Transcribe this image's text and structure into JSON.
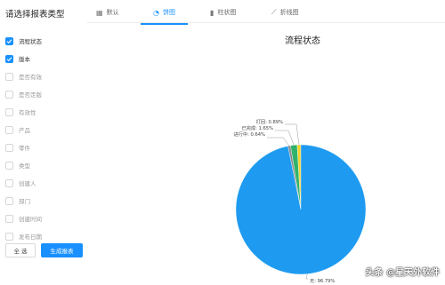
{
  "panel_title": "请选择报表类型",
  "tabs": [
    {
      "icon": "table-icon",
      "label": "默认",
      "active": false
    },
    {
      "icon": "pie-icon",
      "label": "饼图",
      "active": true
    },
    {
      "icon": "bar-icon",
      "label": "柱状图",
      "active": false
    },
    {
      "icon": "line-icon",
      "label": "折线图",
      "active": false
    }
  ],
  "fields": [
    {
      "label": "流程状态",
      "checked": true
    },
    {
      "label": "版本",
      "checked": true
    },
    {
      "label": "是否有效",
      "checked": false
    },
    {
      "label": "是否定版",
      "checked": false
    },
    {
      "label": "有效性",
      "checked": false
    },
    {
      "label": "产品",
      "checked": false
    },
    {
      "label": "零件",
      "checked": false
    },
    {
      "label": "类型",
      "checked": false
    },
    {
      "label": "创建人",
      "checked": false
    },
    {
      "label": "部门",
      "checked": false
    },
    {
      "label": "创建时间",
      "checked": false
    },
    {
      "label": "发布日期",
      "checked": false
    }
  ],
  "buttons": {
    "select_all": "全 选",
    "generate": "生成报表"
  },
  "chart_data": {
    "type": "pie",
    "title": "流程状态",
    "slices": [
      {
        "label": "无",
        "percent": 96.79,
        "label_text": "无: 96.79%",
        "color": "#1e9bf0"
      },
      {
        "label": "进行中",
        "percent": 0.64,
        "label_text": "进行中: 0.64%",
        "color": "#8a8a8a"
      },
      {
        "label": "已完成",
        "percent": 1.65,
        "label_text": "已完成: 1.65%",
        "color": "#2fb36a"
      },
      {
        "label": "打回",
        "percent": 0.89,
        "label_text": "打回: 0.89%",
        "color": "#f5d12a"
      }
    ]
  },
  "watermark": "头条 @星天外软件",
  "colors": {
    "accent": "#1890ff"
  }
}
